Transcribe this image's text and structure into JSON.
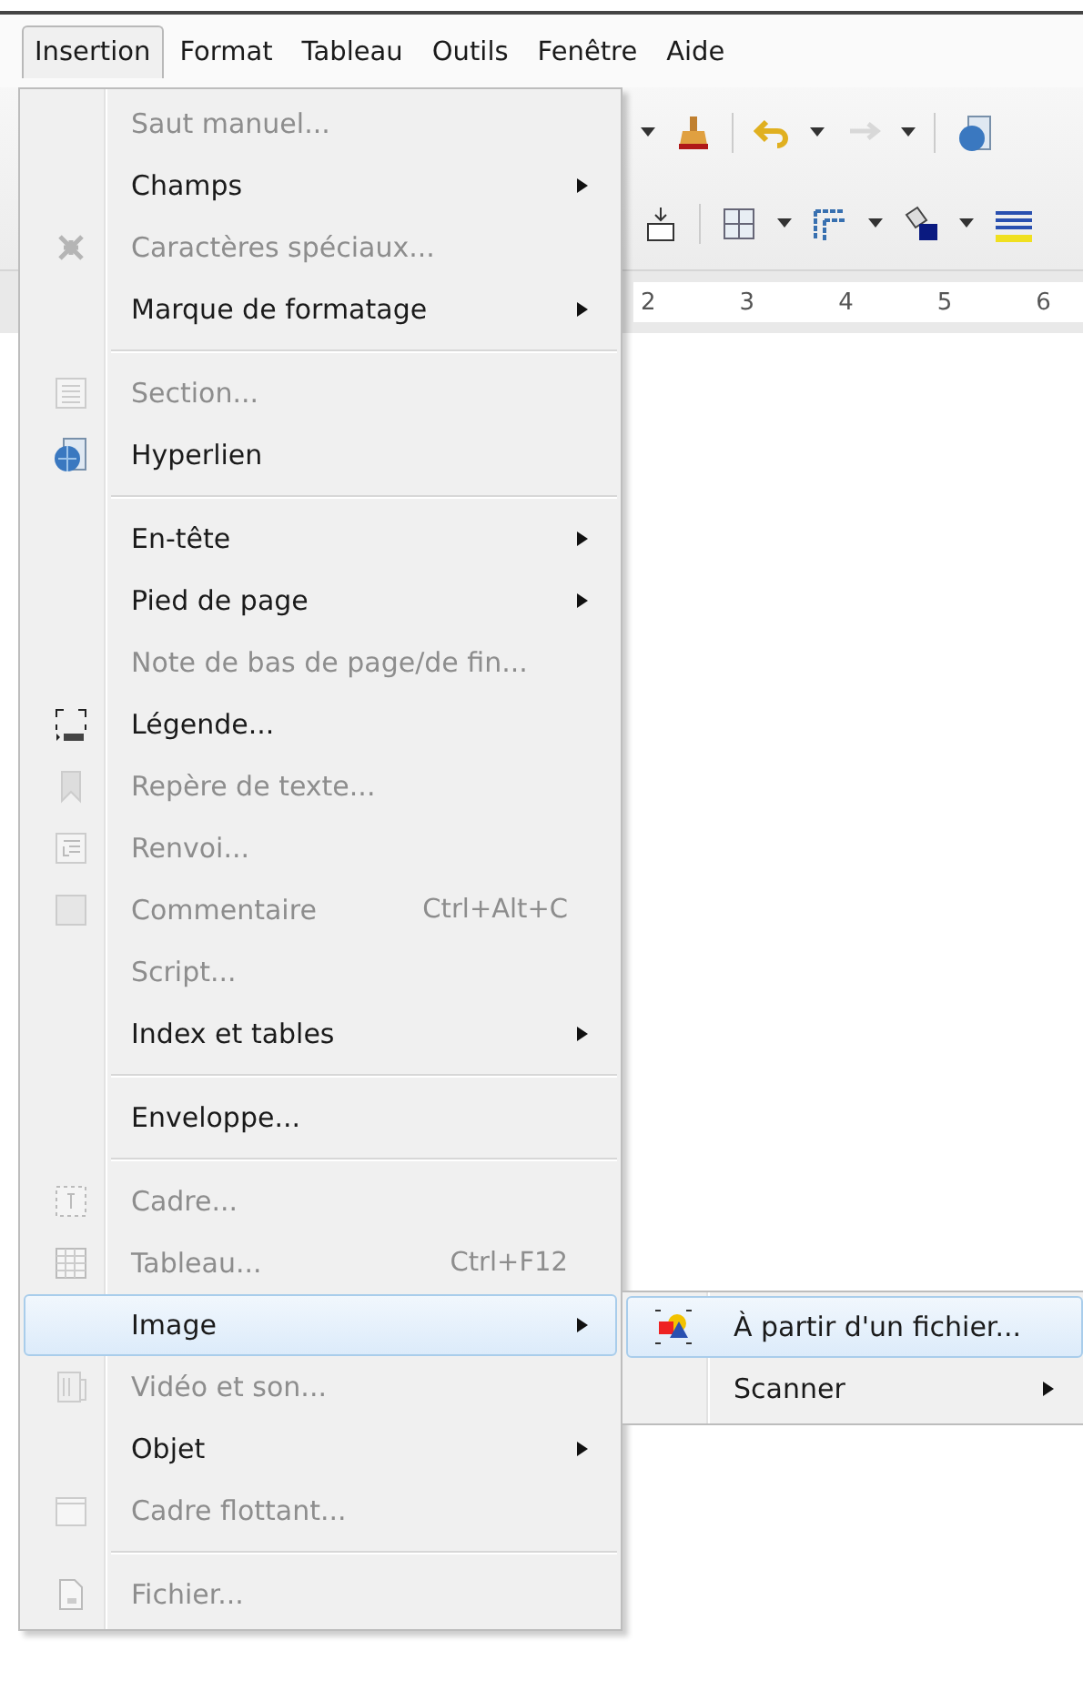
{
  "menubar": [
    {
      "label": "Insertion",
      "selected": true
    },
    {
      "label": "Format",
      "selected": false
    },
    {
      "label": "Tableau",
      "selected": false
    },
    {
      "label": "Outils",
      "selected": false
    },
    {
      "label": "Fenêtre",
      "selected": false
    },
    {
      "label": "Aide",
      "selected": false
    }
  ],
  "ruler": {
    "labels": [
      "2",
      "3",
      "4",
      "5",
      "6"
    ]
  },
  "menu": {
    "items": [
      {
        "kind": "item",
        "label": "Saut manuel...",
        "disabled": true,
        "submenu": false,
        "selected": false
      },
      {
        "kind": "item",
        "label": "Champs",
        "disabled": false,
        "submenu": true,
        "selected": false
      },
      {
        "kind": "item",
        "label": "Caractères spéciaux...",
        "disabled": true,
        "submenu": false,
        "selected": false
      },
      {
        "kind": "item",
        "label": "Marque de formatage",
        "disabled": false,
        "submenu": true,
        "selected": false
      },
      {
        "kind": "separator"
      },
      {
        "kind": "item",
        "label": "Section...",
        "disabled": true,
        "submenu": false,
        "selected": false
      },
      {
        "kind": "item",
        "label": "Hyperlien",
        "disabled": false,
        "submenu": false,
        "selected": false
      },
      {
        "kind": "separator"
      },
      {
        "kind": "item",
        "label": "En-tête",
        "disabled": false,
        "submenu": true,
        "selected": false
      },
      {
        "kind": "item",
        "label": "Pied de page",
        "disabled": false,
        "submenu": true,
        "selected": false
      },
      {
        "kind": "item",
        "label": "Note de bas de page/de fin...",
        "disabled": true,
        "submenu": false,
        "selected": false
      },
      {
        "kind": "item",
        "label": "Légende...",
        "disabled": false,
        "submenu": false,
        "selected": false
      },
      {
        "kind": "item",
        "label": "Repère de texte...",
        "disabled": true,
        "submenu": false,
        "selected": false
      },
      {
        "kind": "item",
        "label": "Renvoi...",
        "disabled": true,
        "submenu": false,
        "selected": false
      },
      {
        "kind": "item",
        "label": "Commentaire",
        "shortcut": "Ctrl+Alt+C",
        "disabled": true,
        "submenu": false,
        "selected": false
      },
      {
        "kind": "item",
        "label": "Script...",
        "disabled": true,
        "submenu": false,
        "selected": false
      },
      {
        "kind": "item",
        "label": "Index et tables",
        "disabled": false,
        "submenu": true,
        "selected": false
      },
      {
        "kind": "separator"
      },
      {
        "kind": "item",
        "label": "Enveloppe...",
        "disabled": false,
        "submenu": false,
        "selected": false
      },
      {
        "kind": "separator"
      },
      {
        "kind": "item",
        "label": "Cadre...",
        "disabled": true,
        "submenu": false,
        "selected": false
      },
      {
        "kind": "item",
        "label": "Tableau...",
        "shortcut": "Ctrl+F12",
        "disabled": true,
        "submenu": false,
        "selected": false
      },
      {
        "kind": "item",
        "label": "Image",
        "disabled": false,
        "submenu": true,
        "selected": true,
        "children": [
          {
            "label": "À partir d'un fichier...",
            "submenu": false,
            "selected": true
          },
          {
            "label": "Scanner",
            "submenu": true,
            "selected": false
          }
        ]
      },
      {
        "kind": "item",
        "label": "Vidéo et son...",
        "disabled": true,
        "submenu": false,
        "selected": false
      },
      {
        "kind": "item",
        "label": "Objet",
        "disabled": false,
        "submenu": true,
        "selected": false
      },
      {
        "kind": "item",
        "label": "Cadre flottant...",
        "disabled": true,
        "submenu": false,
        "selected": false
      },
      {
        "kind": "separator"
      },
      {
        "kind": "item",
        "label": "Fichier...",
        "disabled": true,
        "submenu": false,
        "selected": false
      }
    ]
  }
}
